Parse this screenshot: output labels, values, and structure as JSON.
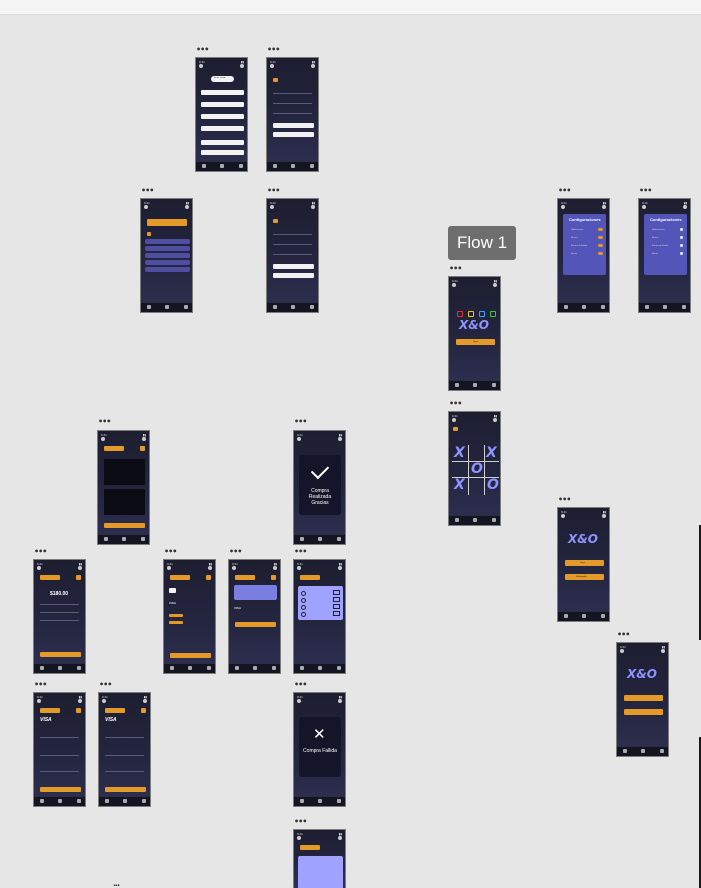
{
  "canvas": {
    "flow_label": "Flow 1",
    "frame_menu": "•••",
    "bottom_menu": "..."
  },
  "screens": {
    "status_time": "9:41",
    "login": {
      "pill": "Iniciar sesion"
    },
    "game": {
      "logo": "X&O",
      "play": "Jugar",
      "board": [
        "X",
        "",
        "X",
        "",
        "O",
        "",
        "X",
        "",
        "O"
      ]
    },
    "menu": {
      "item1": "Jugar",
      "item2": "Multijugador"
    },
    "settings": {
      "title": "Configuraciones",
      "items": [
        "Notificaciones",
        "Musica",
        "Efectos de Sonido",
        "Idioma"
      ]
    },
    "cart": {
      "total": "$180.00"
    },
    "success": {
      "message": "Compra Realizada Gracias"
    },
    "failed": {
      "message": "Compra Fallida"
    },
    "payment": {
      "card_brand": "VISA"
    }
  },
  "colors": {
    "accent": "#e39a28",
    "logo": "#8f93ff",
    "screen_bg": "#24253f",
    "card": "#6b6fd9"
  }
}
